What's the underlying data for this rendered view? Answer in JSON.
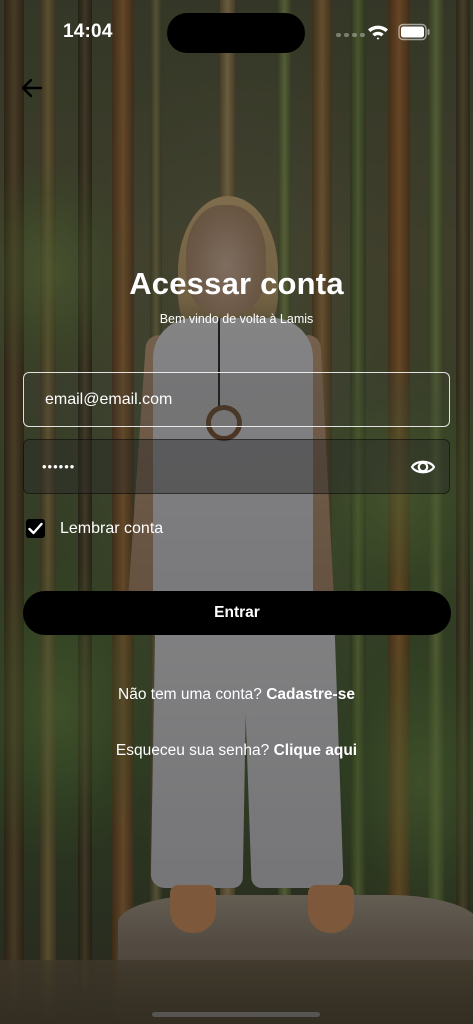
{
  "status_bar": {
    "time": "14:04"
  },
  "header": {
    "back_icon": "arrow-left-icon"
  },
  "login": {
    "title": "Acessar conta",
    "subtitle": "Bem vindo de volta à Lamis",
    "email_value": "email@email.com",
    "password_value": "••••••",
    "password_toggle_icon": "eye-icon",
    "remember_checked": true,
    "remember_label": "Lembrar conta",
    "submit_label": "Entrar"
  },
  "links": {
    "signup_prompt": "Não tem uma conta?",
    "signup_action": "Cadastre-se",
    "forgot_prompt": "Esqueceu sua senha?",
    "forgot_action": "Clique aqui"
  },
  "colors": {
    "button_background": "#000000",
    "text": "#ffffff"
  }
}
